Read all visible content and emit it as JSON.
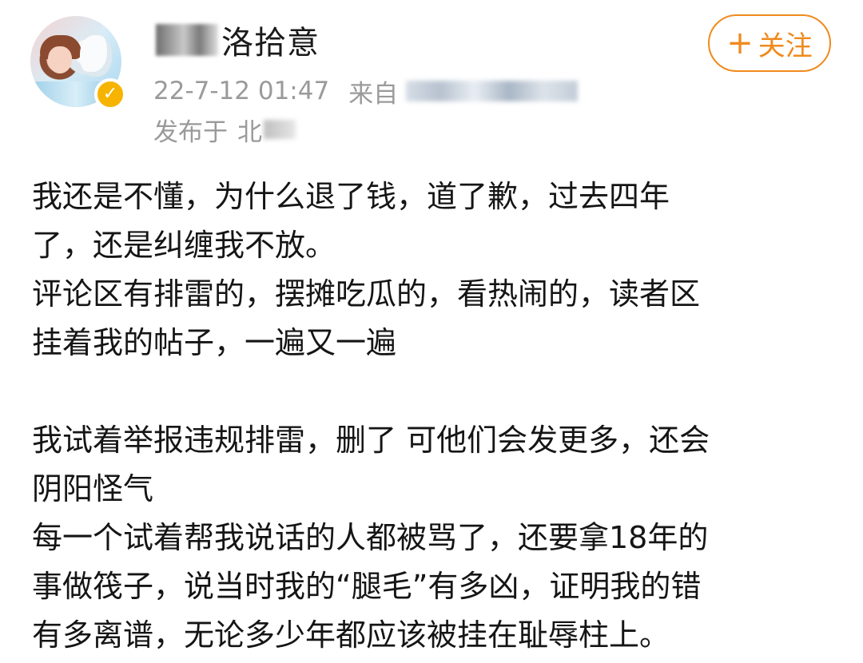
{
  "post": {
    "author": {
      "name_visible": "洛拾意",
      "avatar_icon": "avatar-girl-with-cat",
      "verified_icon": "verified-check-icon"
    },
    "meta": {
      "time": "22-7-12 01:47",
      "source_label": "来自",
      "location_prefix": "发布于",
      "location_value": "北"
    },
    "follow_button": {
      "icon": "plus-icon",
      "icon_glyph": "+",
      "label": "关注"
    },
    "content": {
      "lines": [
        "我还是不懂，为什么退了钱，道了歉，过去四年",
        "了，还是纠缠我不放。",
        "评论区有排雷的，摆摊吃瓜的，看热闹的，读者区",
        "挂着我的帖子，一遍又一遍",
        "",
        "我试着举报违规排雷，删了 可他们会发更多，还会",
        "阴阳怪气",
        "每一个试着帮我说话的人都被骂了，还要拿18年的",
        "事做筏子，说当时我的“腿毛”有多凶，证明我的错",
        "有多离谱，无论多少年都应该被挂在耻辱柱上。"
      ]
    },
    "colors": {
      "accent": "#f08a1d",
      "meta_text": "#9a9a9a",
      "body_text": "#151515",
      "badge": "#f6b400"
    }
  }
}
